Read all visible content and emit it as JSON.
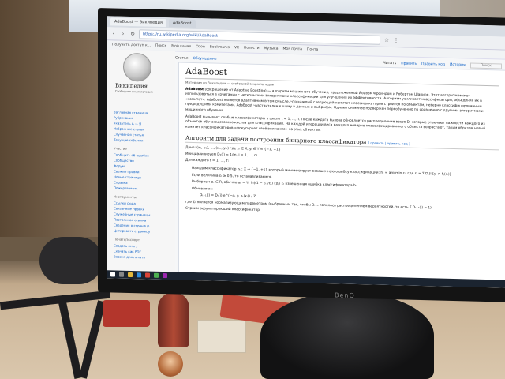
{
  "browser": {
    "tabs": [
      "AdaBoost — Википедия",
      "АdaBoost",
      "Обсуждение"
    ],
    "address": "https://ru.wikipedia.org/wiki/AdaBoost",
    "bookmarks": [
      "Получить доступ к...",
      "Поиск",
      "Мой канал",
      "Ozon",
      "Bookmarks",
      "VK",
      "Новости",
      "Музыка",
      "Моя почта",
      "Почта"
    ]
  },
  "wiki": {
    "logo_text": "Википедия",
    "logo_sub": "Свободная энциклопедия",
    "page_tabs": [
      "Статья",
      "Обсуждение"
    ],
    "page_actions": [
      "Читать",
      "Править",
      "Править код",
      "История",
      "Поиск"
    ],
    "title": "AdaBoost",
    "from": "Материал из Википедии — свободной энциклопедии",
    "intro_1_bold": "AdaBoost",
    "intro_1": "(сокращение от Adaptive Boosting) — алгоритм машинного обучения, предложенный Йоавом Фройндом и Робертом Шапире. Этот алгоритм может использоваться в сочетании с несколькими алгоритмами классификации для улучшения их эффективности. Алгоритм усиливает классификаторы, объединяя их в «комитет». AdaBoost является адаптивным в том смысле, что каждый следующий комитет классификаторов строится по объектам, неверно классифицированным предыдущими комитетами. AdaBoost чувствителен к шуму в данных и выбросам. Однако он менее подвержен переобучению по сравнению с другими алгоритмами машинного обучения.",
    "intro_2": "AdaBoost вызывает слабые классификаторы в цикле t = 1, ..., T. После каждого вызова обновляется распределение весов D, которые отвечают важности каждого из объектов обучающего множества для классификации. На каждой итерации веса каждого неверно классифицированного объекта возрастают, таким образом новый комитет классификаторов «фокусирует своё внимание» на этих объектах.",
    "section": "Алгоритм для задачи построения бинарного классификатора",
    "section_edit": "[ править | править код ]",
    "given": "Дано: (x₁, y₁), ..., (xₘ, yₘ) где xᵢ ∈ X, yᵢ ∈ Y = {−1, +1}",
    "init": "Инициализируем D₁(i) = 1/m, i = 1, ..., m.",
    "loop": "Для каждого t = 1, ..., T:",
    "steps": [
      "Находим классификатор hₜ : X → {−1, +1} который минимизирует взвешенную ошибку классификации: hₜ = arg min εⱼ, где εⱼ = Σ Dₜ(i)[yᵢ ≠ hⱼ(xᵢ)]",
      "Если величина εₜ ≥ 0.5, то останавливаемся.",
      "Выбираем αₜ ∈ R, обычно αₜ = ½ ln((1 − εₜ)/εₜ) где εₜ взвешенная ошибка классификатора hₜ.",
      "Обновляем:",
      "Dₜ₊₁(i) = Dₜ(i) e^(−αₜ yᵢ hₜ(xᵢ)) / Zₜ"
    ],
    "normalize": "где Zₜ является нормализующим параметром (выбранным так, чтобы Dₜ₊₁ являлось распределением вероятностей, то есть Σ Dₜ₊₁(i) = 1).",
    "final": "Строим результирующий классификатор:",
    "sidebar": {
      "links_1": [
        "Заглавная страница",
        "Рубрикация",
        "Указатель А — Я",
        "Избранные статьи",
        "Случайная статья",
        "Текущие события"
      ],
      "head_2": "Участие",
      "links_2": [
        "Сообщить об ошибке",
        "Сообщество",
        "Форум",
        "Свежие правки",
        "Новые страницы",
        "Справка",
        "Пожертвовать"
      ],
      "head_3": "Инструменты",
      "links_3": [
        "Ссылки сюда",
        "Связанные правки",
        "Служебные страницы",
        "Постоянная ссылка",
        "Сведения о странице",
        "Цитировать страницу"
      ],
      "head_4": "Печать/экспорт",
      "links_4": [
        "Создать книгу",
        "Скачать как PDF",
        "Версия для печати"
      ]
    }
  },
  "monitor": {
    "brand": "BenQ"
  },
  "colors": {
    "link": "#0b5fc6",
    "taskbar": "#1b2430",
    "bezel": "#141414"
  }
}
